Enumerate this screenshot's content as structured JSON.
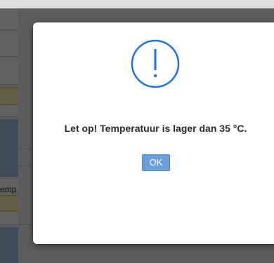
{
  "background": {
    "partial_label": "emp"
  },
  "dialog": {
    "icon": "exclamation-circle-icon",
    "message": "Let op! Temperatuur is lager dan 35 °C.",
    "ok_label": "OK"
  },
  "colors": {
    "accent": "#1a73e8",
    "button": "#6a9fdc",
    "overlay": "#000000"
  }
}
